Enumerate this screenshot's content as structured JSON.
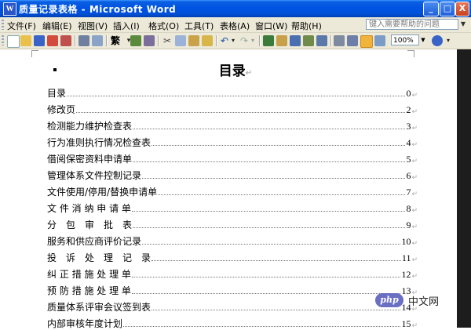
{
  "window": {
    "title": "质量记录表格 - Microsoft Word",
    "app_icon": "W",
    "minimize": "_",
    "maximize": "□",
    "close": "X"
  },
  "menu": {
    "items": [
      {
        "label": "文件(F)"
      },
      {
        "label": "编辑(E)"
      },
      {
        "label": "视图(V)"
      },
      {
        "label": "插入(I)"
      },
      {
        "label": "格式(O)"
      },
      {
        "label": "工具(T)"
      },
      {
        "label": "表格(A)"
      },
      {
        "label": "窗口(W)"
      },
      {
        "label": "帮助(H)"
      }
    ],
    "help_placeholder": "键入需要帮助的问题"
  },
  "toolbar": {
    "zoom": "100%",
    "font_label": "繁"
  },
  "document": {
    "title": "目录",
    "paragraph_mark": "↵",
    "toc": [
      {
        "label": "目录",
        "page": "0"
      },
      {
        "label": "修改页",
        "page": "2"
      },
      {
        "label": "检测能力维护检查表",
        "page": "3"
      },
      {
        "label": "行为准则执行情况检查表",
        "page": "4"
      },
      {
        "label": "借阅保密资料申请单",
        "page": "5"
      },
      {
        "label": "管理体系文件控制记录",
        "page": "6"
      },
      {
        "label": "文件使用/停用/替换申请单",
        "page": "7"
      },
      {
        "label": "文 件 消 纳 申 请 单",
        "page": "8"
      },
      {
        "label": "分　包　审　批　表",
        "page": "9"
      },
      {
        "label": "服务和供应商评价记录",
        "page": "10"
      },
      {
        "label": "投　诉　处　理　记　录",
        "page": "11"
      },
      {
        "label": "纠 正 措 施 处 理 单",
        "page": "12"
      },
      {
        "label": "预 防 措 施 处 理 单",
        "page": "13"
      },
      {
        "label": "质量体系评审会议签到表",
        "page": "14"
      },
      {
        "label": "内部审核年度计划",
        "page": "15"
      }
    ]
  },
  "watermark": {
    "logo": "php",
    "text": "中文网"
  },
  "colors": {
    "titlebar": "#0054e3",
    "chrome": "#ece9d8"
  }
}
